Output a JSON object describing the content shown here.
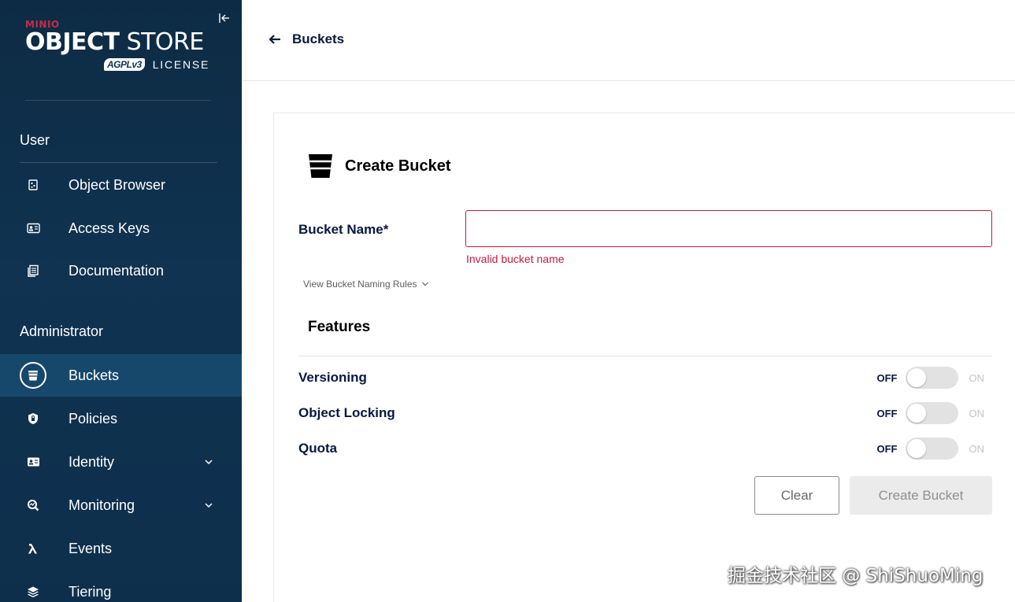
{
  "sidebar": {
    "brand": "MINIO",
    "product_bold": "OBJECT",
    "product_regular": "STORE",
    "license_badge": "AGPLv3",
    "license_text": "LICENSE",
    "collapse_icon": "collapse-left-icon",
    "user_section": {
      "title": "User",
      "items": [
        {
          "label": "Object Browser",
          "icon": "object-browser-icon"
        },
        {
          "label": "Access Keys",
          "icon": "access-keys-icon"
        },
        {
          "label": "Documentation",
          "icon": "documentation-icon"
        }
      ]
    },
    "admin_section": {
      "title": "Administrator",
      "items": [
        {
          "label": "Buckets",
          "icon": "bucket-icon",
          "active": true
        },
        {
          "label": "Policies",
          "icon": "shield-icon"
        },
        {
          "label": "Identity",
          "icon": "identity-icon",
          "expandable": true
        },
        {
          "label": "Monitoring",
          "icon": "monitoring-icon",
          "expandable": true
        },
        {
          "label": "Events",
          "icon": "lambda-icon"
        },
        {
          "label": "Tiering",
          "icon": "layers-icon"
        }
      ]
    }
  },
  "topbar": {
    "back_label": "Buckets"
  },
  "form": {
    "title": "Create Bucket",
    "bucket_name_label": "Bucket Name*",
    "bucket_name_value": "",
    "error": "Invalid bucket name",
    "rules_link": "View Bucket Naming Rules",
    "features_title": "Features",
    "features": [
      {
        "label": "Versioning",
        "off_label": "OFF",
        "on_label": "ON",
        "enabled": false
      },
      {
        "label": "Object Locking",
        "off_label": "OFF",
        "on_label": "ON",
        "enabled": false
      },
      {
        "label": "Quota",
        "off_label": "OFF",
        "on_label": "ON",
        "enabled": false
      }
    ],
    "clear_label": "Clear",
    "create_label": "Create Bucket"
  },
  "watermark": "掘金技术社区 @ ShiShuoMing",
  "colors": {
    "sidebar_bg": "#0f3351",
    "active_item": "#16486b",
    "brand_red": "#c72c48",
    "error_red": "#c51b3d",
    "text_dark": "#07193e"
  }
}
